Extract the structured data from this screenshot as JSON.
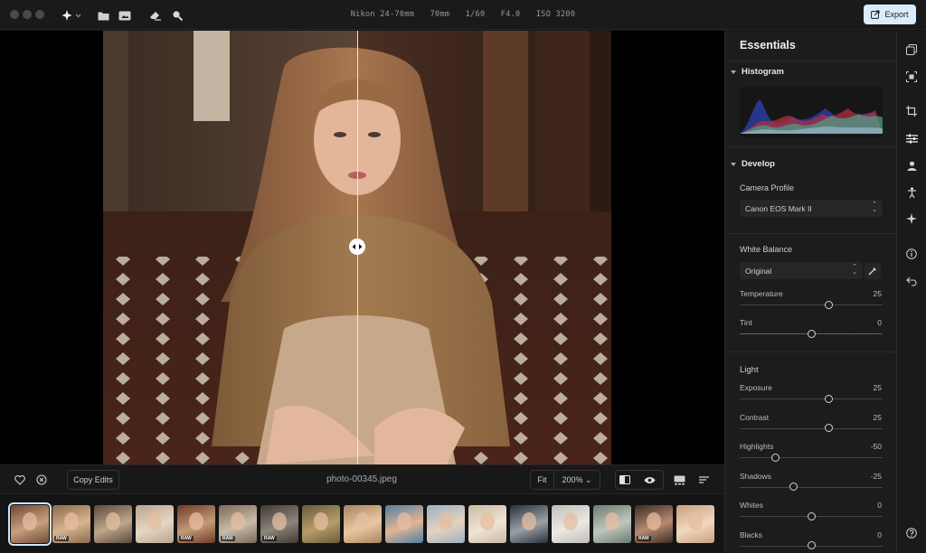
{
  "camera_info": {
    "lens": "Nikon 24-70mm",
    "focal": "70mm",
    "shutter": "1/60",
    "aperture": "F4.0",
    "iso": "ISO 3200"
  },
  "toolbar": {
    "export_label": "Export"
  },
  "bottom": {
    "copy_edits": "Copy Edits",
    "filename": "photo-00345.jpeg",
    "fit_label": "Fit",
    "zoom_label": "200%"
  },
  "panel": {
    "title": "Essentials",
    "histogram_label": "Histogram",
    "develop_label": "Develop",
    "camera_profile": {
      "label": "Camera Profile",
      "value": "Canon EOS Mark II"
    },
    "white_balance": {
      "label": "White Balance",
      "value": "Original"
    },
    "wb_sliders": [
      {
        "name": "Temperature",
        "value": "25",
        "level": 0.625
      },
      {
        "name": "Tint",
        "value": "0",
        "level": 0.5
      }
    ],
    "light_label": "Light",
    "light_sliders": [
      {
        "name": "Exposure",
        "value": "25",
        "level": 0.625
      },
      {
        "name": "Contrast",
        "value": "25",
        "level": 0.625
      },
      {
        "name": "Highlights",
        "value": "-50",
        "level": 0.25
      },
      {
        "name": "Shadows",
        "value": "-25",
        "level": 0.375
      },
      {
        "name": "Whites",
        "value": "0",
        "level": 0.5
      },
      {
        "name": "Blacks",
        "value": "0",
        "level": 0.5
      }
    ]
  },
  "filmstrip": [
    {
      "badge": "",
      "selected": true,
      "colors": [
        "#6b4a35",
        "#c9a07f"
      ]
    },
    {
      "badge": "RAW",
      "colors": [
        "#8a6a4e",
        "#d8b48f"
      ]
    },
    {
      "badge": "",
      "colors": [
        "#5a4a3c",
        "#bfa68c"
      ]
    },
    {
      "badge": "",
      "colors": [
        "#b8a48e",
        "#e6d6c2"
      ]
    },
    {
      "badge": "RAW",
      "colors": [
        "#6e3b27",
        "#c49a78"
      ]
    },
    {
      "badge": "RAW",
      "colors": [
        "#7b6a58",
        "#c8bca8"
      ]
    },
    {
      "badge": "RAW",
      "colors": [
        "#3f3a36",
        "#8d847a"
      ]
    },
    {
      "badge": "",
      "colors": [
        "#6a5a3c",
        "#b89d6a"
      ]
    },
    {
      "badge": "",
      "colors": [
        "#a88460",
        "#e8c8a2"
      ]
    },
    {
      "badge": "",
      "colors": [
        "#4e7ea3",
        "#e2b596"
      ]
    },
    {
      "badge": "",
      "colors": [
        "#9ab0c2",
        "#e6d2c0"
      ]
    },
    {
      "badge": "",
      "colors": [
        "#c9b9a3",
        "#efe4d4"
      ]
    },
    {
      "badge": "",
      "colors": [
        "#2a3038",
        "#9aa0a8"
      ]
    },
    {
      "badge": "",
      "colors": [
        "#c0bcb8",
        "#ece8e4"
      ]
    },
    {
      "badge": "",
      "colors": [
        "#6c7a70",
        "#bfc7bd"
      ]
    },
    {
      "badge": "RAW",
      "colors": [
        "#3a2a26",
        "#b88a70"
      ]
    },
    {
      "badge": "",
      "colors": [
        "#c7a07e",
        "#f0d8bf"
      ]
    }
  ],
  "icons": {
    "top": [
      "magic-wand-icon",
      "folder-icon",
      "image-import-icon",
      "eraser-icon",
      "search-icon"
    ],
    "rail": [
      "layers-icon",
      "focus-icon",
      "crop-icon",
      "adjust-sliders-icon",
      "portrait-icon",
      "body-icon",
      "sparkle-icon",
      "info-icon",
      "undo-icon",
      "help-icon"
    ]
  },
  "colors": {
    "accent": "#d9ecfb",
    "panel_bg": "#1c1c1c"
  }
}
